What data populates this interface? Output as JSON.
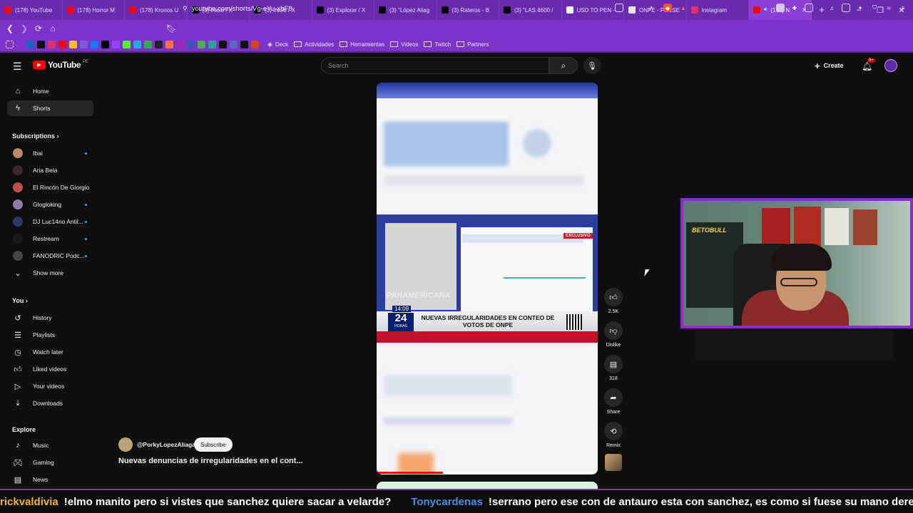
{
  "browser": {
    "tabs": [
      {
        "title": "(178) YouTube",
        "icon": "youtube-icon",
        "color": "#ff0000"
      },
      {
        "title": "(178) Horror M",
        "icon": "youtube-icon",
        "color": "#ff0000"
      },
      {
        "title": "(178) Kronos U",
        "icon": "youtube-icon",
        "color": "#ff0000"
      },
      {
        "title": "(3) Inicio / X",
        "icon": "x-icon",
        "color": "#000000"
      },
      {
        "title": "(3) Inicio / X",
        "icon": "x-icon",
        "color": "#000000"
      },
      {
        "title": "(3) Explorar / X",
        "icon": "x-icon",
        "color": "#000000"
      },
      {
        "title": "(3) \"López Aliag",
        "icon": "x-icon",
        "color": "#000000"
      },
      {
        "title": "(3) Rateros - B",
        "icon": "x-icon",
        "color": "#000000"
      },
      {
        "title": "(3) \"LAS 4600 /",
        "icon": "x-icon",
        "color": "#000000"
      },
      {
        "title": "USD TO PEN -",
        "icon": "google-icon",
        "color": "#ffffff"
      },
      {
        "title": "ONPE - PRESE",
        "icon": "document-icon",
        "color": "#e8e8e8"
      },
      {
        "title": "Instagram",
        "icon": "instagram-icon",
        "color": "#e1306c"
      },
      {
        "title": "(178) N",
        "icon": "youtube-icon",
        "color": "#ff0000",
        "active": true
      }
    ],
    "new_tab": "+",
    "minimize": "–",
    "maximize": "❐",
    "close": "✕",
    "url": "youtube.com/shorts/Vg-eYu-xbF8",
    "bookmarks_folders": [
      "Deck",
      "Actividades",
      "Herramientas",
      "Videos",
      "Twitch",
      "Partners"
    ]
  },
  "youtube": {
    "logo": "YouTube",
    "region": "PE",
    "search_placeholder": "Search",
    "create_label": "Create",
    "notif_count": "9+",
    "nav": [
      {
        "label": "Home",
        "icon": "home-icon"
      },
      {
        "label": "Shorts",
        "icon": "shorts-icon",
        "selected": true
      }
    ],
    "subscriptions_header": "Subscriptions",
    "subscriptions": [
      {
        "label": "Ibai",
        "color": "#b88a6a",
        "dot": true
      },
      {
        "label": "Aria Bela",
        "color": "#3b2a2a",
        "dot": false
      },
      {
        "label": "El Rincón De Giorgio",
        "color": "#c0504d",
        "dot": false
      },
      {
        "label": "Glogloking",
        "color": "#8c7aa9",
        "dot": true
      },
      {
        "label": "DJ Luc14no Antil...",
        "color": "#2d3a66",
        "dot": true
      },
      {
        "label": "Restream",
        "color": "#1a1a1a",
        "dot": true
      },
      {
        "label": "FANODRIC Podc...",
        "color": "#444444",
        "dot": true
      }
    ],
    "show_more": "Show more",
    "you_header": "You",
    "you_items": [
      {
        "label": "History",
        "icon": "history-icon"
      },
      {
        "label": "Playlists",
        "icon": "playlists-icon"
      },
      {
        "label": "Watch later",
        "icon": "watch-later-icon"
      },
      {
        "label": "Liked videos",
        "icon": "like-icon"
      },
      {
        "label": "Your videos",
        "icon": "your-videos-icon"
      },
      {
        "label": "Downloads",
        "icon": "download-icon"
      }
    ],
    "explore_header": "Explore",
    "explore_items": [
      {
        "label": "Music",
        "icon": "music-icon"
      },
      {
        "label": "Gaming",
        "icon": "gaming-icon"
      },
      {
        "label": "News",
        "icon": "news-icon"
      }
    ],
    "short": {
      "channel": "@PorkyLopezAliaga",
      "subscribe": "Subscribe",
      "title": "Nuevas denuncias de irregularidades en el cont...",
      "likes": "2.5K",
      "dislike": "Dislike",
      "comments": "318",
      "share": "Share",
      "remix": "Remix",
      "overlay_time": "14:09",
      "overlay_channel": "24",
      "overlay_channel_sub": "HORAS",
      "overlay_headline": "NUEVAS IRREGULARIDADES EN CONTEO DE VOTOS DE ONPE",
      "overlay_badge": "EXCLUSIVO",
      "overlay_watermark": "PANAMERICANA"
    }
  },
  "stream": {
    "cam_text": "BETOBULL",
    "chat": [
      {
        "user": "rickvaldivia",
        "user_color": "#f7b733",
        "message": "!elmo manito pero si vistes que sanchez quiere sacar a velarde?"
      },
      {
        "user": "Tonycardenas",
        "user_color": "#4a90e2",
        "message": "!serrano pero ese con de antauro esta con sanchez, es como si fuese su mano derecha xd"
      }
    ]
  }
}
